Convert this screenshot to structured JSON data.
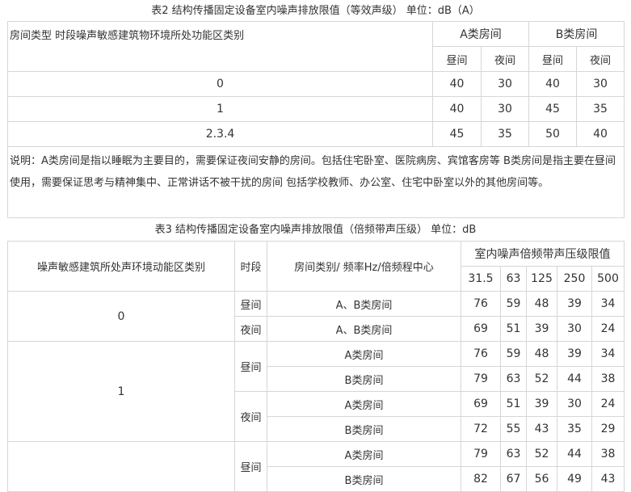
{
  "table2": {
    "caption": "表2 结构传播固定设备室内噪声排放限值（等效声级） 单位：dB（A）",
    "corner": "房间类型 时段噪声敏感建筑物环境所处功能区类别",
    "room_a": "A类房间",
    "room_b": "B类房间",
    "day": "昼间",
    "night": "夜间",
    "rows": [
      {
        "zone": "0",
        "a_day": "40",
        "a_night": "30",
        "b_day": "40",
        "b_night": "30"
      },
      {
        "zone": "1",
        "a_day": "40",
        "a_night": "30",
        "b_day": "45",
        "b_night": "35"
      },
      {
        "zone": "2.3.4",
        "a_day": "45",
        "a_night": "35",
        "b_day": "50",
        "b_night": "40"
      }
    ],
    "note": "说明：A类房间是指以睡眠为主要目的，需要保证夜间安静的房间。包括住宅卧室、医院病房、宾馆客房等 B类房间是指主要在昼间使用，需要保证思考与精神集中、正常讲话不被干扰的房间 包括学校教师、办公室、住宅中卧室以外的其他房间等。"
  },
  "table3": {
    "caption": "表3 结构传播固定设备室内噪声排放限值（倍频带声压级） 单位：dB",
    "col_zone": "噪声敏感建筑所处声环境动能区类别",
    "col_period": "时段",
    "col_room": "房间类别/ 频率Hz/倍频程中心",
    "col_limits": "室内噪声倍频带声压级限值",
    "freqs": [
      "31.5",
      "63",
      "125",
      "250",
      "500"
    ],
    "zone0": {
      "zone": "0",
      "day": "昼间",
      "day_room": "A、B类房间",
      "day_vals": [
        "76",
        "59",
        "48",
        "39",
        "34"
      ],
      "night": "夜间",
      "night_room": "A、B类房间",
      "night_vals": [
        "69",
        "51",
        "39",
        "30",
        "24"
      ]
    },
    "zone1": {
      "zone": "1",
      "day": "昼间",
      "day_a": "A类房间",
      "day_a_vals": [
        "76",
        "59",
        "48",
        "39",
        "34"
      ],
      "day_b": "B类房间",
      "day_b_vals": [
        "79",
        "63",
        "52",
        "44",
        "38"
      ],
      "night": "夜间",
      "night_a": "A类房间",
      "night_a_vals": [
        "69",
        "51",
        "39",
        "30",
        "24"
      ],
      "night_b": "B类房间",
      "night_b_vals": [
        "72",
        "55",
        "43",
        "35",
        "29"
      ]
    },
    "zone2": {
      "day": "昼间",
      "day_a": "A类房间",
      "day_a_vals": [
        "79",
        "63",
        "52",
        "44",
        "38"
      ],
      "day_b": "B类房间",
      "day_b_vals": [
        "82",
        "67",
        "56",
        "49",
        "43"
      ]
    }
  }
}
